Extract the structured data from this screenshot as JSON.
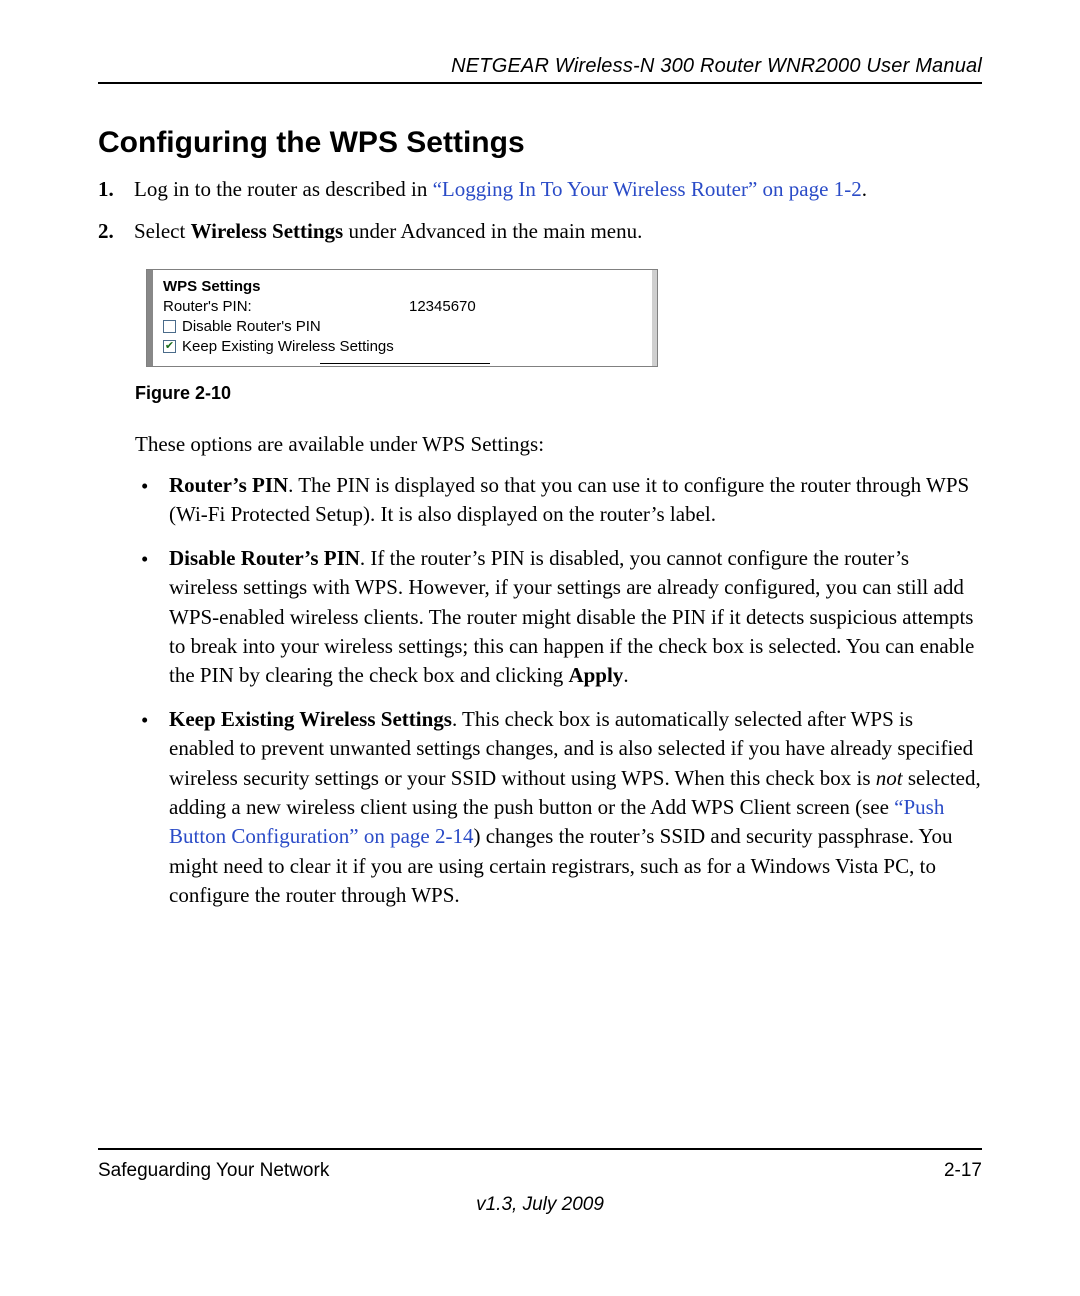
{
  "header": {
    "doc_title": "NETGEAR Wireless-N 300 Router WNR2000 User Manual"
  },
  "heading": "Configuring the WPS Settings",
  "steps": {
    "s1_pre": "Log in to the router as described in ",
    "s1_link": "“Logging In To Your Wireless Router” on page 1-2",
    "s1_post": ".",
    "s2_pre": "Select ",
    "s2_bold": "Wireless Settings",
    "s2_post": " under Advanced in the main menu."
  },
  "figure": {
    "panel_title": "WPS Settings",
    "pin_label": "Router's PIN:",
    "pin_value": "12345670",
    "cb_disable": "Disable Router's PIN",
    "cb_keep": "Keep Existing Wireless Settings",
    "caption": "Figure 2-10"
  },
  "intro_line": "These options are available under WPS Settings:",
  "bullets": {
    "b1_bold": "Router’s PIN",
    "b1_rest": ". The PIN is displayed so that you can use it to configure the router through WPS (Wi-Fi Protected Setup). It is also displayed on the router’s label.",
    "b2_bold": "Disable Router’s PIN",
    "b2_rest_a": ". If the router’s PIN is disabled, you cannot configure the router’s wireless settings with WPS. However, if your settings are already configured, you can still add WPS-enabled wireless clients. The router might disable the PIN if it detects suspicious attempts to break into your wireless settings; this can happen if the check box is selected. You can enable the PIN by clearing the check box and clicking ",
    "b2_rest_apply": "Apply",
    "b2_rest_b": ".",
    "b3_bold": "Keep Existing Wireless Settings",
    "b3_rest_a": ". This check box is automatically selected after WPS is enabled to prevent unwanted settings changes, and is also selected if you have already specified wireless security settings or your SSID without using WPS. When this check box is ",
    "b3_not": "not",
    "b3_rest_b": " selected, adding a new wireless client using the push button or the Add WPS Client screen (see ",
    "b3_link": "“Push Button Configuration” on page 2-14",
    "b3_rest_c": ") changes the router’s SSID and security passphrase. You might need to clear it if you are using certain registrars, such as for a Windows Vista PC, to configure the router through WPS."
  },
  "footer": {
    "chapter": "Safeguarding Your Network",
    "page_num": "2-17",
    "version": "v1.3, July 2009"
  }
}
